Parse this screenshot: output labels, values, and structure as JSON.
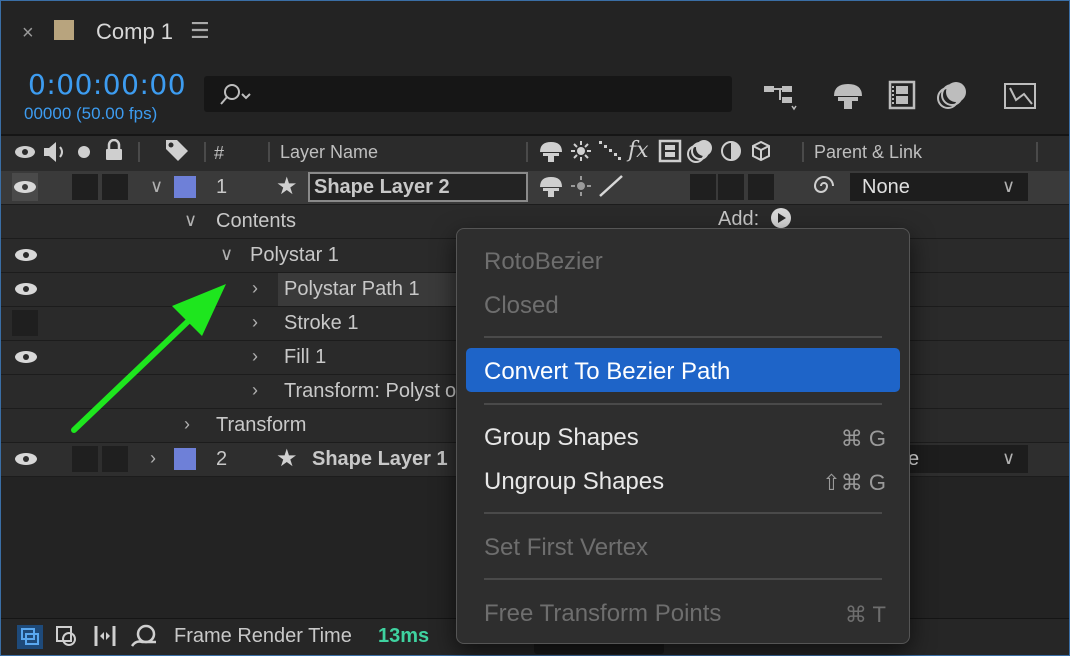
{
  "window": {
    "close": "×",
    "title": "Comp 1",
    "menu": "☰",
    "label_color": "#b8a47e"
  },
  "time": {
    "timecode": "0:00:00:00",
    "frames_fps": "00000 (50.00 fps)",
    "accent": "#3d9cf0"
  },
  "search": {
    "placeholder": ""
  },
  "header": {
    "num": "#",
    "layer_name": "Layer Name",
    "fx": "fx",
    "parent_link": "Parent & Link"
  },
  "layers": [
    {
      "num": "1",
      "name": "Shape Layer 2",
      "parent": "None",
      "label_color": "#6e80d8"
    },
    {
      "num": "2",
      "name": "Shape Layer 1",
      "parent_partial": "e",
      "label_color": "#6e80d8"
    }
  ],
  "tree": {
    "contents": "Contents",
    "add": "Add:",
    "polystar": "Polystar 1",
    "polystar_path": "Polystar Path 1",
    "stroke": "Stroke 1",
    "fill": "Fill 1",
    "transform_polystar": "Transform: Polyst",
    "transform_partial_tail": "o",
    "transform": "Transform"
  },
  "footer": {
    "label": "Frame Render Time",
    "value": "13ms",
    "value_color": "#3fd2a0"
  },
  "context_menu": {
    "items": [
      {
        "label": "RotoBezier",
        "shortcut": "",
        "enabled": false
      },
      {
        "label": "Closed",
        "shortcut": "",
        "enabled": false
      },
      {
        "label": "Convert To Bezier Path",
        "shortcut": "",
        "enabled": true,
        "highlighted": true
      },
      {
        "label": "Group Shapes",
        "shortcut": "⌘ G",
        "enabled": true
      },
      {
        "label": "Ungroup Shapes",
        "shortcut": "⇧⌘ G",
        "enabled": true
      },
      {
        "label": "Set First Vertex",
        "shortcut": "",
        "enabled": false
      },
      {
        "label": "Free Transform Points",
        "shortcut": "⌘ T",
        "enabled": false
      }
    ],
    "highlight_color": "#1e64c8"
  },
  "annotation": {
    "arrow_color": "#1ee61e"
  }
}
